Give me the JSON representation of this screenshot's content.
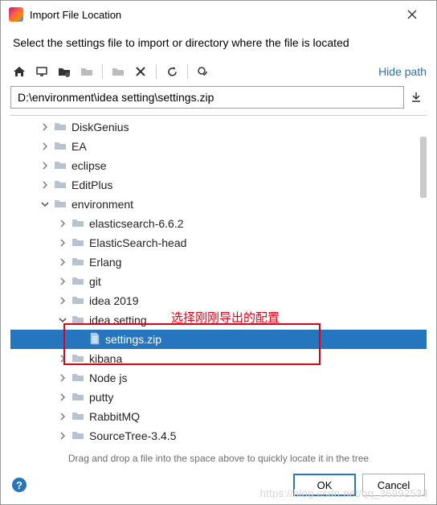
{
  "window": {
    "title": "Import File Location"
  },
  "subtitle": "Select the settings file to import or directory where the file is located",
  "link": {
    "hide_path": "Hide path"
  },
  "path": {
    "value": "D:\\environment\\idea setting\\settings.zip"
  },
  "tree": [
    {
      "indent": 1,
      "expanded": false,
      "type": "folder",
      "label": "DiskGenius"
    },
    {
      "indent": 1,
      "expanded": false,
      "type": "folder",
      "label": "EA"
    },
    {
      "indent": 1,
      "expanded": false,
      "type": "folder",
      "label": "eclipse"
    },
    {
      "indent": 1,
      "expanded": false,
      "type": "folder",
      "label": "EditPlus"
    },
    {
      "indent": 1,
      "expanded": true,
      "type": "folder",
      "label": "environment"
    },
    {
      "indent": 2,
      "expanded": false,
      "type": "folder",
      "label": "elasticsearch-6.6.2"
    },
    {
      "indent": 2,
      "expanded": false,
      "type": "folder",
      "label": "ElasticSearch-head"
    },
    {
      "indent": 2,
      "expanded": false,
      "type": "folder",
      "label": "Erlang"
    },
    {
      "indent": 2,
      "expanded": false,
      "type": "folder",
      "label": "git"
    },
    {
      "indent": 2,
      "expanded": false,
      "type": "folder",
      "label": "idea 2019"
    },
    {
      "indent": 2,
      "expanded": true,
      "type": "folder",
      "label": "idea setting"
    },
    {
      "indent": 3,
      "expanded": null,
      "type": "file",
      "label": "settings.zip",
      "selected": true
    },
    {
      "indent": 2,
      "expanded": false,
      "type": "folder",
      "label": "kibana"
    },
    {
      "indent": 2,
      "expanded": false,
      "type": "folder",
      "label": "Node js"
    },
    {
      "indent": 2,
      "expanded": false,
      "type": "folder",
      "label": "putty"
    },
    {
      "indent": 2,
      "expanded": false,
      "type": "folder",
      "label": "RabbitMQ"
    },
    {
      "indent": 2,
      "expanded": false,
      "type": "folder",
      "label": "SourceTree-3.4.5"
    }
  ],
  "hint": "Drag and drop a file into the space above to quickly locate it in the tree",
  "annotation": {
    "text": "选择刚刚导出的配置"
  },
  "buttons": {
    "ok": "OK",
    "cancel": "Cancel"
  },
  "watermark": "https://blog.csdn.net/qq_36992534"
}
